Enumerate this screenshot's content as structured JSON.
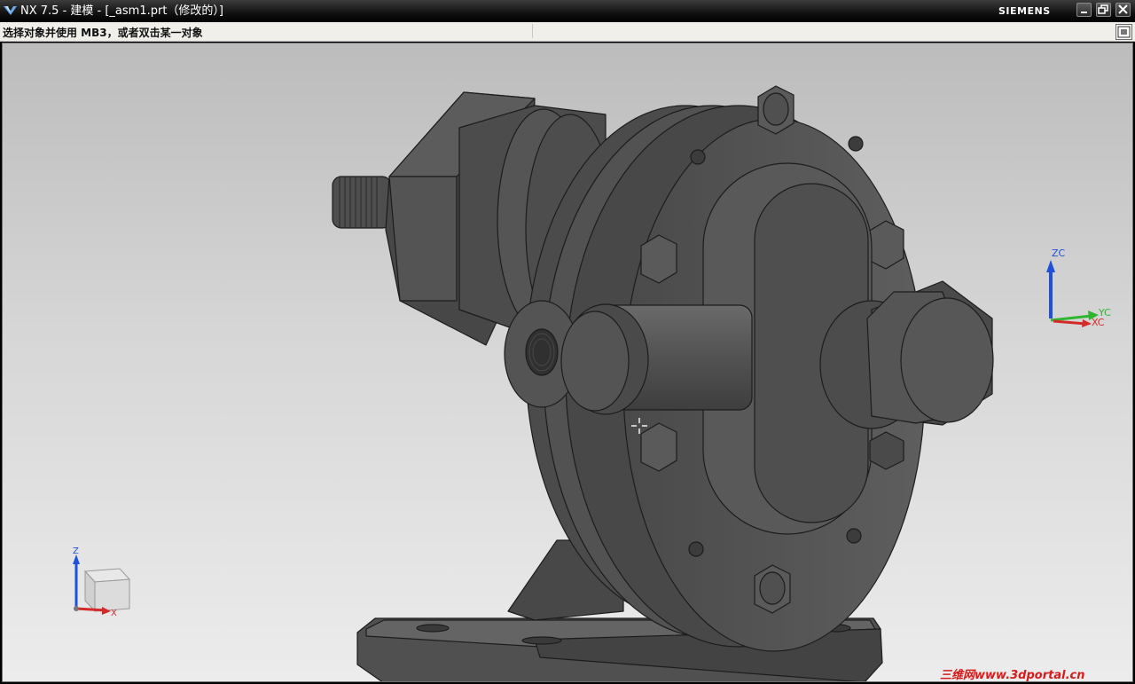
{
  "window": {
    "title": "NX 7.5 - 建模 - [_asm1.prt（修改的）]",
    "brand": "SIEMENS"
  },
  "status": {
    "prompt": "选择对象并使用 MB3，或者双击某一对象"
  },
  "triad": {
    "labels": {
      "zc": "ZC",
      "yc": "YC",
      "xc": "XC"
    },
    "colors": {
      "z": "#1f50d8",
      "y": "#2fb52f",
      "x": "#d42a2a"
    }
  },
  "mini_triad": {
    "labels": {
      "z": "Z",
      "x": "X"
    }
  },
  "watermark": "三维网www.3dportal.cn",
  "icons": [
    "nx-logo-icon",
    "minimize-icon",
    "restore-icon",
    "close-icon",
    "fit-view-icon",
    "cursor-crosshair-icon"
  ]
}
